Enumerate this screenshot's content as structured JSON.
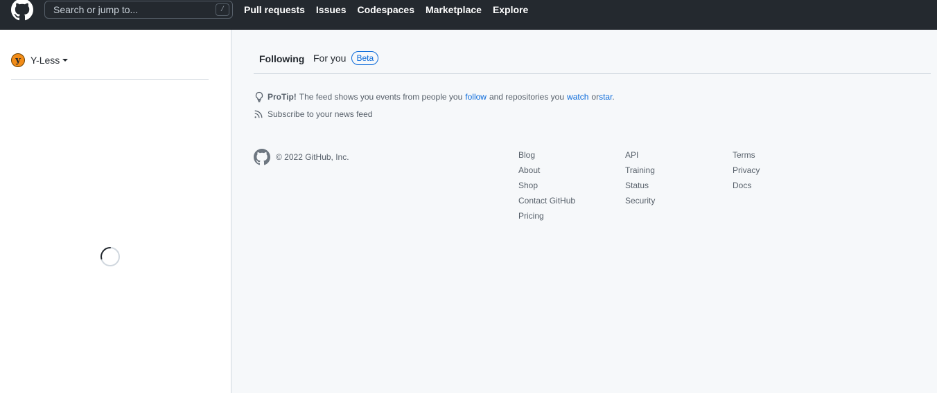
{
  "header": {
    "search_placeholder": "Search or jump to...",
    "search_shortcut": "/",
    "nav": [
      "Pull requests",
      "Issues",
      "Codespaces",
      "Marketplace",
      "Explore"
    ]
  },
  "sidebar": {
    "context_user": "Y-Less",
    "avatar_letter": "y"
  },
  "feed": {
    "tabs": {
      "following": "Following",
      "for_you": "For you",
      "beta_badge": "Beta"
    },
    "protip": {
      "label": "ProTip!",
      "text1": "The feed shows you events from people you",
      "link_follow": "follow",
      "text2": "and repositories you",
      "link_watch": "watch",
      "text3": "or",
      "link_star": "star",
      "end": "."
    },
    "subscribe": "Subscribe to your news feed"
  },
  "footer": {
    "copyright": "© 2022 GitHub, Inc.",
    "col1": [
      "Blog",
      "About",
      "Shop",
      "Contact GitHub",
      "Pricing"
    ],
    "col2": [
      "API",
      "Training",
      "Status",
      "Security"
    ],
    "col3": [
      "Terms",
      "Privacy",
      "Docs"
    ]
  },
  "colors": {
    "header_bg": "#24292f",
    "link": "#0969da",
    "page_bg": "#f6f8fa"
  }
}
